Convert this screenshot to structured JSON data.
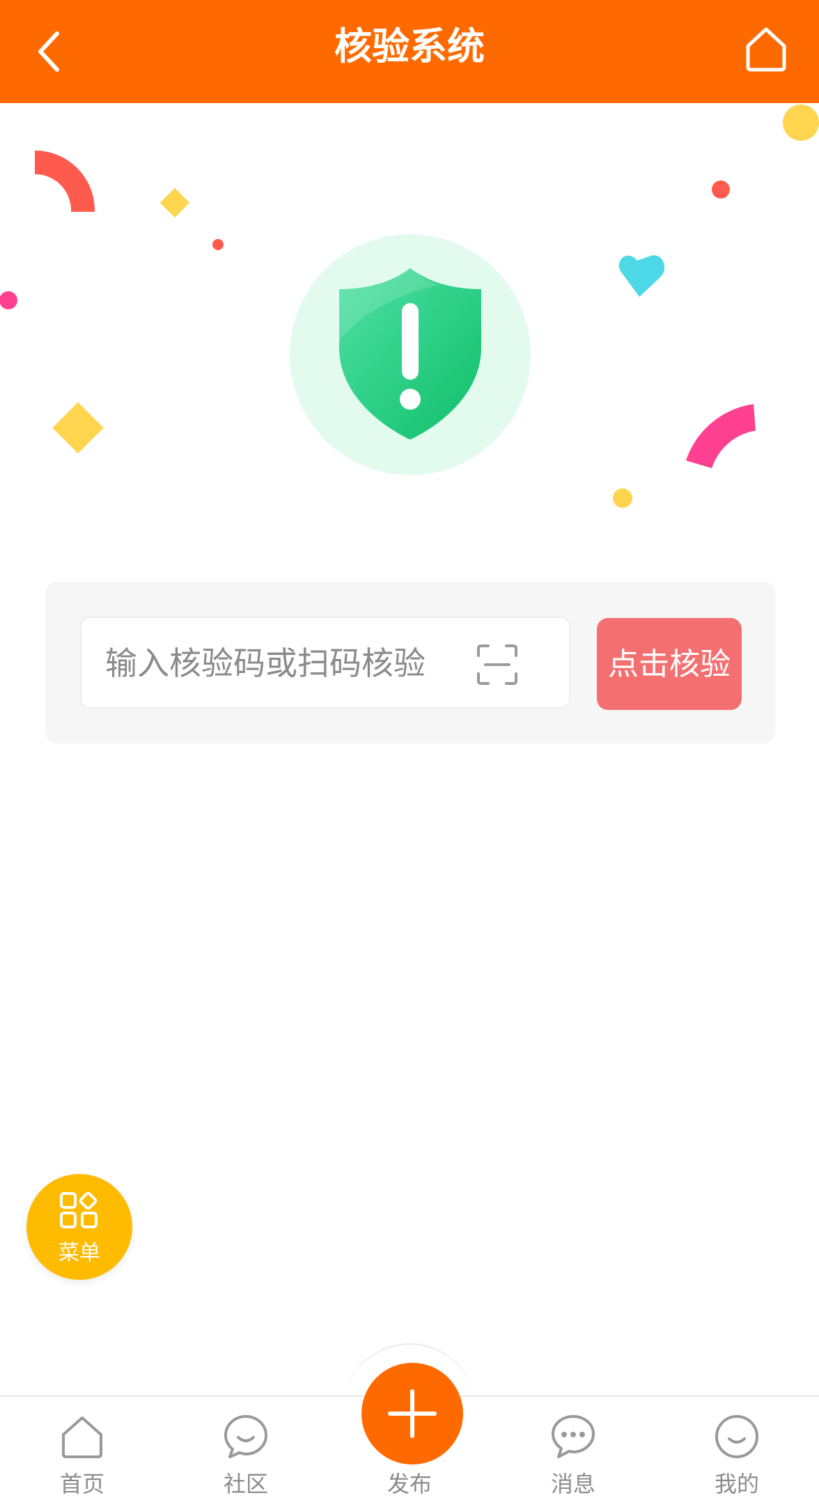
{
  "header": {
    "title": "核验系统"
  },
  "verify": {
    "input_placeholder": "输入核验码或扫码核验",
    "input_value": "",
    "button_label": "点击核验"
  },
  "float_menu": {
    "label": "菜单"
  },
  "tabbar": {
    "items": [
      {
        "label": "首页",
        "icon": "home-icon"
      },
      {
        "label": "社区",
        "icon": "chat-smile-icon"
      },
      {
        "label": "发布",
        "icon": "plus-icon"
      },
      {
        "label": "消息",
        "icon": "message-dots-icon"
      },
      {
        "label": "我的",
        "icon": "profile-smile-icon"
      }
    ]
  },
  "colors": {
    "header_bg": "#ff6a00",
    "verify_button": "#f47070",
    "shield_green": "#1fc77a",
    "float_menu": "#ffbb00",
    "tab_text": "#8c8c8c"
  }
}
